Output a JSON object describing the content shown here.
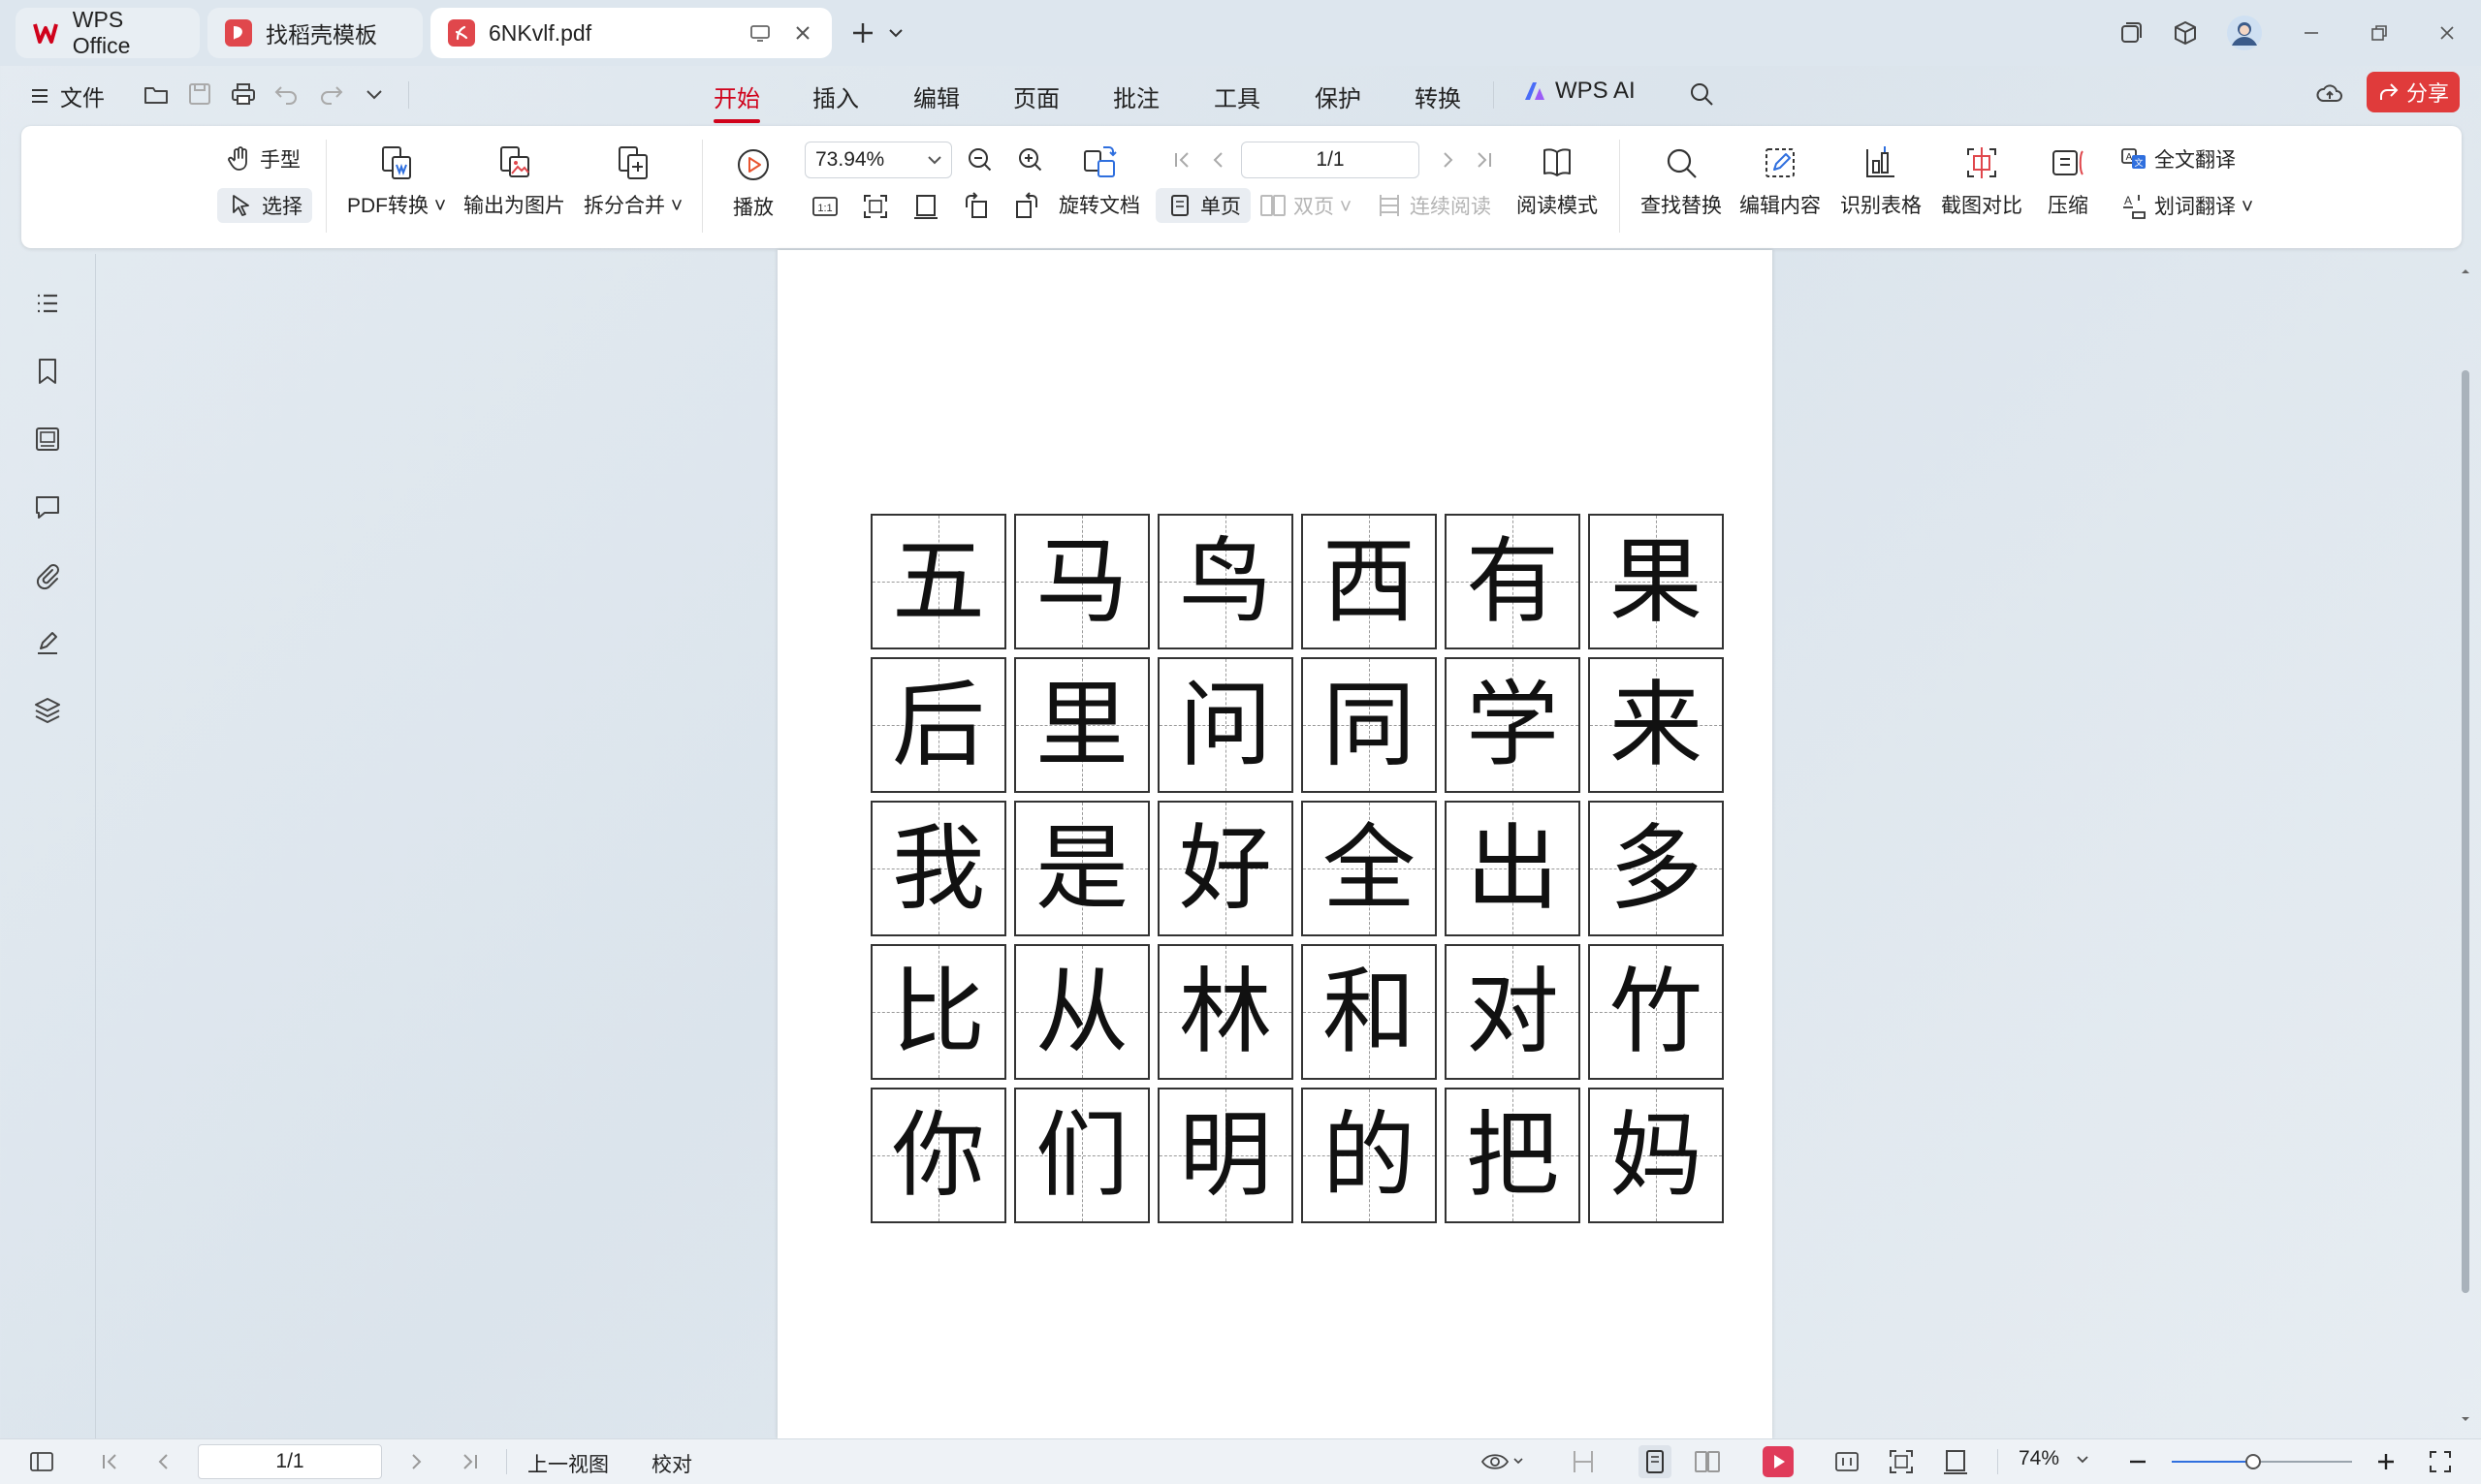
{
  "tabs": [
    {
      "label": "WPS Office",
      "icon": "wps-logo-icon"
    },
    {
      "label": "找稻壳模板",
      "icon": "docer-icon"
    },
    {
      "label": "6NKvlf.pdf",
      "icon": "pdf-icon"
    }
  ],
  "menu": {
    "file": "文件",
    "items": [
      "开始",
      "插入",
      "编辑",
      "页面",
      "批注",
      "工具",
      "保护",
      "转换"
    ],
    "active": "开始",
    "ai": "WPS AI",
    "share": "分享"
  },
  "ribbon": {
    "hand": "手型",
    "select": "选择",
    "pdf_convert": "PDF转换",
    "export_image": "输出为图片",
    "split_merge": "拆分合并",
    "play": "播放",
    "zoom": "73.94%",
    "page": "1/1",
    "rotate_doc": "旋转文档",
    "single_page": "单页",
    "double_page": "双页",
    "continuous": "连续阅读",
    "read_mode": "阅读模式",
    "find_replace": "查找替换",
    "edit_content": "编辑内容",
    "recognize_table": "识别表格",
    "screenshot_compare": "截图对比",
    "compress": "压缩",
    "full_translate": "全文翻译",
    "word_translate": "划词翻译"
  },
  "document": {
    "characters": [
      [
        "五",
        "马",
        "鸟",
        "西",
        "有",
        "果"
      ],
      [
        "后",
        "里",
        "问",
        "同",
        "学",
        "来"
      ],
      [
        "我",
        "是",
        "好",
        "全",
        "出",
        "多"
      ],
      [
        "比",
        "从",
        "林",
        "和",
        "对",
        "竹"
      ],
      [
        "你",
        "们",
        "明",
        "的",
        "把",
        "妈"
      ]
    ]
  },
  "status": {
    "page": "1/1",
    "prev_view": "上一视图",
    "proofread": "校对",
    "zoom": "74%",
    "zoom_fraction": 0.45
  },
  "colors": {
    "accent": "#d0021b",
    "share": "#e03b3b"
  }
}
